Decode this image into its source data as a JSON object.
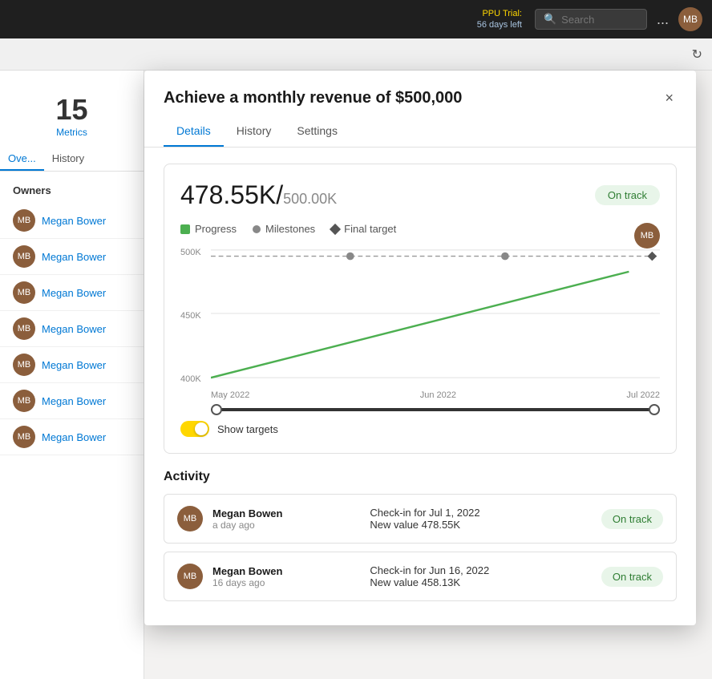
{
  "topbar": {
    "ppu_trial": "PPU Trial:",
    "days_left": "56 days left",
    "search_placeholder": "Search",
    "dots_label": "...",
    "avatar_initials": "MB"
  },
  "secondbar": {
    "refresh_title": "Refresh"
  },
  "sidebar": {
    "metrics_count": "15",
    "metrics_label": "Metrics",
    "tabs": [
      {
        "label": "Ove...",
        "active": true
      },
      {
        "label": "History",
        "active": false
      }
    ],
    "owners_header": "Owners",
    "owners": [
      {
        "name": "Megan Bower",
        "initials": "MB"
      },
      {
        "name": "Megan Bower",
        "initials": "MB"
      },
      {
        "name": "Megan Bower",
        "initials": "MB"
      },
      {
        "name": "Megan Bower",
        "initials": "MB"
      },
      {
        "name": "Megan Bower",
        "initials": "MB"
      },
      {
        "name": "Megan Bower",
        "initials": "MB"
      },
      {
        "name": "Megan Bower",
        "initials": "MB"
      }
    ]
  },
  "dialog": {
    "title": "Achieve a monthly revenue of $500,000",
    "tabs": [
      {
        "label": "Details",
        "active": true
      },
      {
        "label": "History",
        "active": false
      },
      {
        "label": "Settings",
        "active": false
      }
    ],
    "close_label": "×",
    "chart": {
      "current_value": "478.55K",
      "separator": "/",
      "target_value": "500.00K",
      "status_badge": "On track",
      "legend": [
        {
          "type": "green-rect",
          "label": "Progress"
        },
        {
          "type": "gray-dot",
          "label": "Milestones"
        },
        {
          "type": "diamond",
          "label": "Final target"
        }
      ],
      "y_labels": [
        "500K",
        "450K",
        "400K"
      ],
      "x_labels": [
        "May 2022",
        "Jun 2022",
        "Jul 2022"
      ],
      "show_targets_label": "Show targets",
      "avatar_initials": "MB"
    },
    "activity": {
      "title": "Activity",
      "items": [
        {
          "name": "Megan Bowen",
          "time": "a day ago",
          "check_in": "Check-in for Jul 1, 2022",
          "new_value": "New value 478.55K",
          "status": "On track",
          "initials": "MB"
        },
        {
          "name": "Megan Bowen",
          "time": "16 days ago",
          "check_in": "Check-in for Jun 16, 2022",
          "new_value": "New value 458.13K",
          "status": "On track",
          "initials": "MB"
        }
      ]
    }
  }
}
